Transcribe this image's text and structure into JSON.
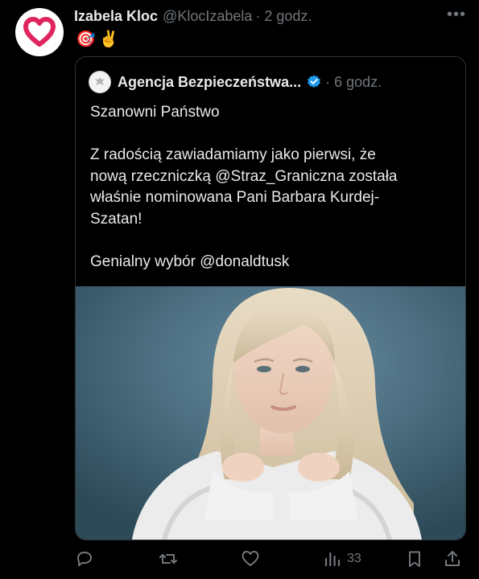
{
  "tweet": {
    "author_name": "Izabela Kloc",
    "handle": "@KlocIzabela",
    "time": "· 2 godz.",
    "emoji": [
      "🎯",
      "✌️"
    ]
  },
  "quoted": {
    "author_name": "Agencja Bezpieczeństwa...",
    "time": "· 6 godz.",
    "lines": [
      "Szanowni Państwo",
      "",
      "Z radością zawiadamiamy jako pierwsi, że",
      "nową rzeczniczką @Straz_Graniczna została",
      "właśnie nominowana Pani Barbara Kurdej-",
      "Szatan!",
      "",
      "Genialny wybór @donaldtusk"
    ]
  },
  "actions": {
    "views": "33"
  },
  "colors": {
    "background": "#000000",
    "text": "#e7e9ea",
    "muted": "#71767b",
    "verified": "#1d9bf0",
    "avatar_heart": "#e0245e"
  }
}
